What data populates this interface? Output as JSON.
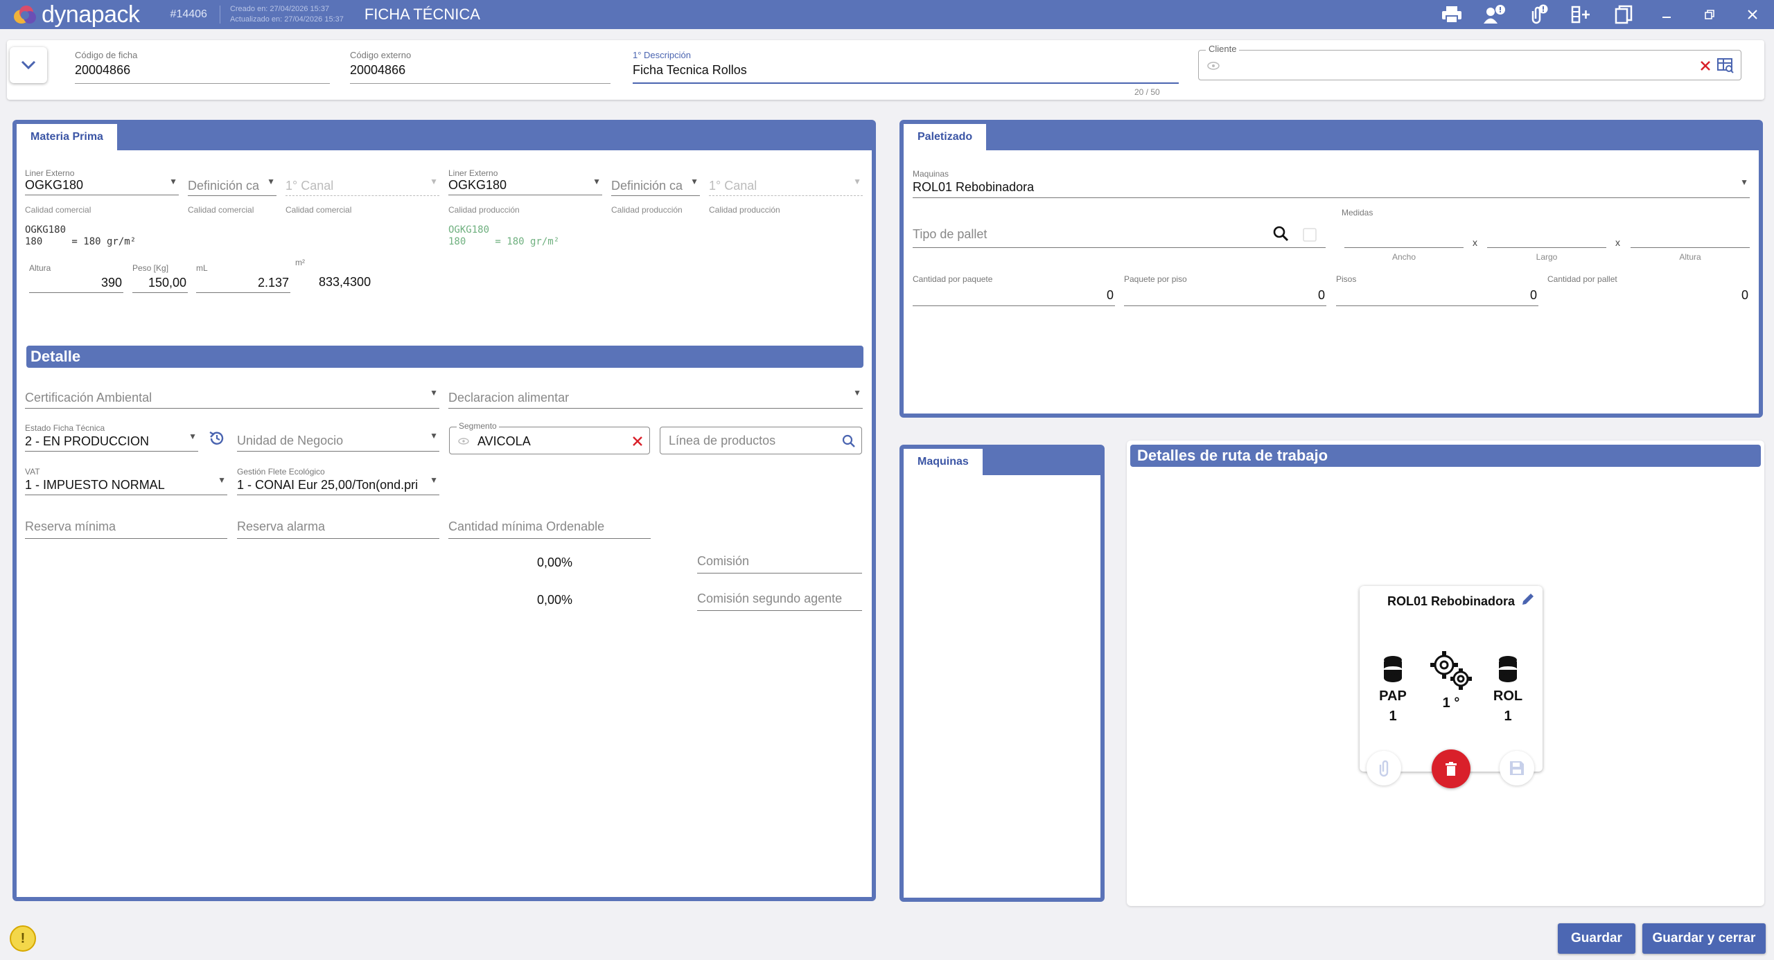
{
  "app": {
    "logo_text": "dynapack",
    "record_id": "#14406",
    "created": "Creado en: 27/04/2026 15:37",
    "updated": "Actualizado en: 27/04/2026 15:37",
    "title": "FICHA TÉCNICA"
  },
  "window_icons": [
    "print-icon",
    "users-alert-icon",
    "attachment-alert-icon",
    "add-column-icon",
    "copy-icon",
    "minimize-icon",
    "restore-icon",
    "close-icon"
  ],
  "window_glyphs": {
    "print": "🖶",
    "users": "👥",
    "attach": "📎",
    "addcol": "⊞",
    "copy": "❐",
    "min": "–",
    "restore": "❐",
    "close": "✕"
  },
  "header": {
    "codigo_ficha_label": "Código de ficha",
    "codigo_ficha": "20004866",
    "codigo_externo_label": "Código externo",
    "codigo_externo": "20004866",
    "descripcion_label": "1° Descripción",
    "descripcion": "Ficha Tecnica Rollos",
    "descripcion_counter": "20 / 50",
    "cliente_label": "Cliente",
    "toggle_glyph": "⌄",
    "clear_glyph": "✕",
    "table_glyph": "⊞",
    "eye_glyph": "◉"
  },
  "materia_prima": {
    "tab": "Materia Prima",
    "liner_ext_label": "Liner Externo",
    "liner_ext": "OGKG180",
    "def_ca": "Definición ca",
    "canal": "1° Canal",
    "calidad_comercial": "Calidad comercial",
    "calidad_produccion": "Calidad producción",
    "mono1_a": "OGKG180",
    "mono1_b": "180     = 180 gr/m²",
    "liner_ext_label2": "Liner Externo",
    "liner_ext2": "OGKG180",
    "mono2_a": "OGKG180",
    "mono2_b": "180     = 180 gr/m²",
    "altura_label": "Altura",
    "altura": "390",
    "peso_label": "Peso [Kg]",
    "peso": "150,00",
    "ml_label": "mL",
    "ml": "2.137",
    "m2_label": "m²",
    "m2": "833,4300"
  },
  "detalle": {
    "title": "Detalle",
    "cert_ambiental": "Certificación Ambiental",
    "declaracion": "Declaracion alimentar",
    "estado_label": "Estado Ficha Técnica",
    "estado": "2 - EN PRODUCCION",
    "unidad_negocio": "Unidad de Negocio",
    "segmento_label": "Segmento",
    "segmento": "AVICOLA",
    "linea_productos": "Línea de productos",
    "vat_label": "VAT",
    "vat": "1 - IMPUESTO NORMAL",
    "gestion_label": "Gestión Flete Ecológico",
    "gestion": "1 - CONAI Eur 25,00/Ton(ond.pri",
    "reserva_minima": "Reserva mínima",
    "reserva_alarma": "Reserva alarma",
    "cantidad_minima": "Cantidad mínima Ordenable",
    "pct1": "0,00%",
    "pct2": "0,00%",
    "comision": "Comisión",
    "comision_segundo": "Comisión segundo agente",
    "history_glyph": "⟲",
    "search_glyph": "⌕"
  },
  "paletizado": {
    "tab": "Paletizado",
    "maquinas_label": "Maquinas",
    "maquinas": "ROL01 Rebobinadora",
    "medidas_label": "Medidas",
    "tipo_pallet": "Tipo de pallet",
    "ancho": "Ancho",
    "largo": "Largo",
    "altura": "Altura",
    "x1": "x",
    "x2": "x",
    "cant_paquete_label": "Cantidad por paquete",
    "cant_paquete": "0",
    "paquete_piso_label": "Paquete por piso",
    "paquete_piso": "0",
    "pisos_label": "Pisos",
    "pisos": "0",
    "cant_pallet_label": "Cantidad por pallet",
    "cant_pallet": "0"
  },
  "maquinas_panel": {
    "tab": "Maquinas"
  },
  "ruta": {
    "title": "Detalles de ruta de trabajo",
    "card_title": "ROL01 Rebobinadora",
    "left_code": "PAP",
    "left_num": "1",
    "mid_label": "1 °",
    "right_code": "ROL",
    "right_num": "1"
  },
  "footer": {
    "guardar": "Guardar",
    "guardar_cerrar": "Guardar y cerrar",
    "warning_glyph": "!"
  },
  "colors": {
    "accent": "#5a73b8",
    "button": "#4c67b3",
    "delete": "#d9202a",
    "segment_x": "#d9202a"
  }
}
